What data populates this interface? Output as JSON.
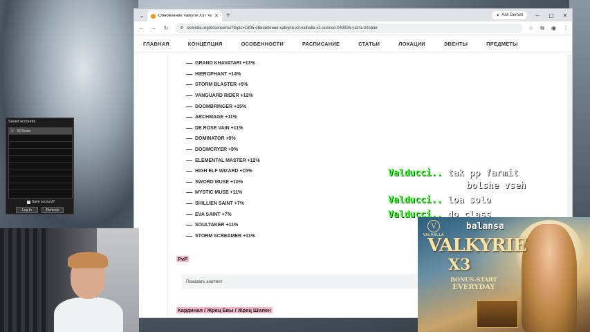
{
  "overlay_top_text": "",
  "browser": {
    "tab_title": "Обновление Valkyrie X3 / Valha",
    "ask_gemini": "Ask Gemini",
    "url": "esendia.org/essence/ru/?topic=1805-обновление-valkyrie-x3-valhalla-x1-sunrise-040926-часть-вторая"
  },
  "site_nav": [
    "ГЛАВНАЯ",
    "КОНЦЕПЦИЯ",
    "ОСОБЕННОСТИ",
    "РАСПИСАНИЕ",
    "СТАТЬИ",
    "ЛОКАЦИИ",
    "ЭВЕНТЫ",
    "ПРЕДМЕТЫ"
  ],
  "class_list": [
    "GRAND KHAVATARI +13%",
    "HIEROPHANT +14%",
    "STORM BLASTER +5%",
    "VANGUARD RIDER +12%",
    "DOOMBRINGER +15%",
    "ARCHMAGE +11%",
    "DE ROSE VAIN +11%",
    "DOMINATOR +9%",
    "DOOMCRYER +9%",
    "ELEMENTAL MASTER +12%",
    "HIGH ELF WIZARD +15%",
    "SWORD MUSE +10%",
    "MYSTIC MUSE +11%",
    "SHILLIEN SAINT +7%",
    "EVA SAINT +7%",
    "SOULTAKER +11%",
    "STORM SCREAMER +11%"
  ],
  "pvp_heading": "PvP",
  "show_content": "Показать контент",
  "priest_heading": "Кардинал / Жрец Евы / Жрец Шилен",
  "accounts": {
    "title": "Saved accounts",
    "rows": [
      {
        "num": "1",
        "name": "SPRcatv"
      }
    ],
    "save_label": "Save account?",
    "login": "Log In",
    "remove": "Remove"
  },
  "chat": [
    {
      "user": "Valducci..",
      "msg": "tak pp farmit"
    },
    {
      "user": "",
      "msg": "bolshe vseh"
    },
    {
      "user": "Valducci..",
      "msg": "loa solo"
    },
    {
      "user": "Valducci..",
      "msg": "do class"
    },
    {
      "user": "",
      "msg": "balansa"
    }
  ],
  "ad": {
    "brand": "VALHALLA",
    "emblem": "V",
    "title": "VALKYRIE",
    "title2": "X3",
    "bonus": "BONUS-START",
    "every": "EVERYDAY"
  },
  "colors": {
    "chat_user": "#3aff2a",
    "chat_msg": "#ffffff",
    "heading_highlight": "#f3b6c6"
  }
}
